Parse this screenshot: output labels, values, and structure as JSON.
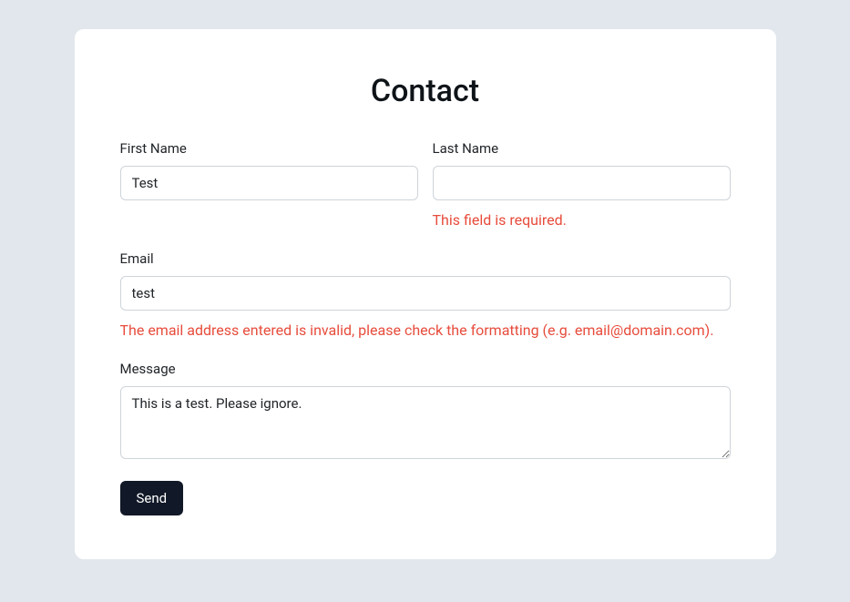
{
  "title": "Contact",
  "fields": {
    "firstName": {
      "label": "First Name",
      "value": "Test"
    },
    "lastName": {
      "label": "Last Name",
      "value": "",
      "error": "This field is required."
    },
    "email": {
      "label": "Email",
      "value": "test",
      "error": "The email address entered is invalid, please check the formatting (e.g. email@domain.com)."
    },
    "message": {
      "label": "Message",
      "value": "This is a test. Please ignore."
    }
  },
  "submit": {
    "label": "Send"
  }
}
